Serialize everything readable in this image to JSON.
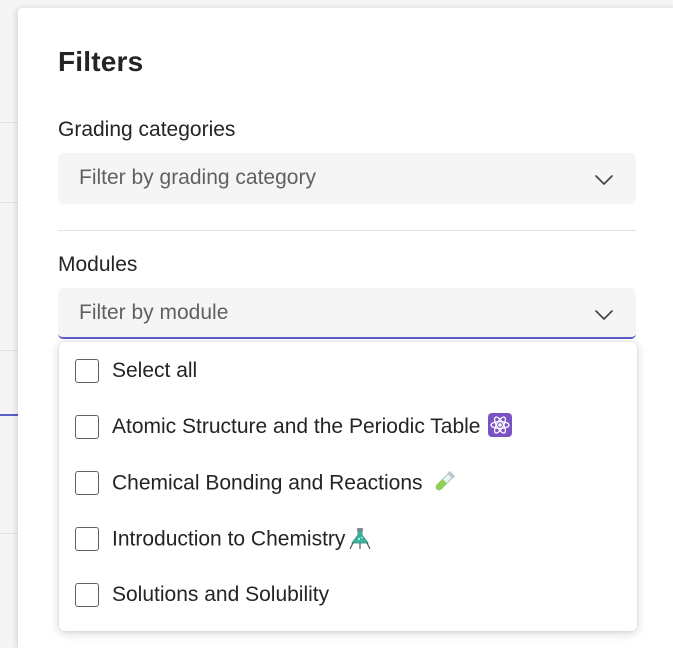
{
  "panel": {
    "title": "Filters"
  },
  "grading": {
    "label": "Grading categories",
    "placeholder": "Filter by grading category"
  },
  "modules": {
    "label": "Modules",
    "placeholder": "Filter by module",
    "options": [
      {
        "label": "Select all",
        "checked": false,
        "icon": ""
      },
      {
        "label": "Atomic Structure and the Periodic Table",
        "checked": false,
        "icon": "atom-icon"
      },
      {
        "label": "Chemical Bonding and Reactions",
        "checked": false,
        "icon": "test-tube-icon"
      },
      {
        "label": "Introduction to Chemistry",
        "checked": false,
        "icon": "lab-flask-icon"
      },
      {
        "label": "Solutions and Solubility",
        "checked": false,
        "icon": ""
      }
    ]
  },
  "colors": {
    "accent": "#5b5fc7",
    "atom_bg": "#7b52c4",
    "tube_green": "#8fd14f",
    "flask_teal": "#3fb59f"
  }
}
